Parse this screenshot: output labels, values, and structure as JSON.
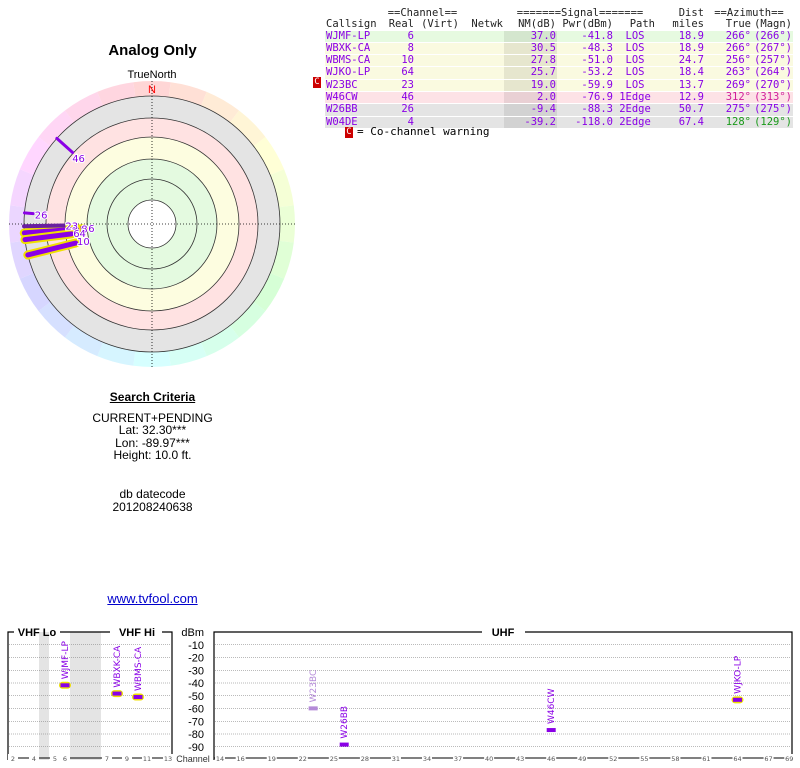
{
  "report": {
    "title": "Analog Only",
    "north_label": "TrueNorth",
    "north_marker": "N"
  },
  "table": {
    "group_headers": {
      "channel": "==Channel==",
      "signal": "=======Signal=======",
      "dist": "Dist",
      "azimuth": "==Azimuth=="
    },
    "headers": [
      "Callsign",
      "Real",
      "(Virt)",
      "Netwk",
      "NM(dB)",
      "Pwr(dBm)",
      "Path",
      "miles",
      "True",
      "(Magn)"
    ],
    "rows": [
      {
        "callsign": "WJMF-LP",
        "real": "6",
        "virt": "",
        "netwk": "",
        "nm": "37.0",
        "pwr": "-41.8",
        "path": "LOS",
        "dist": "18.9",
        "true": "266°",
        "magn": "(266°)",
        "bg": "#e6fae0",
        "az_color": "#8a00e6",
        "cochannel": false
      },
      {
        "callsign": "WBXK-CA",
        "real": "8",
        "virt": "",
        "netwk": "",
        "nm": "30.5",
        "pwr": "-48.3",
        "path": "LOS",
        "dist": "18.9",
        "true": "266°",
        "magn": "(267°)",
        "bg": "#fafae0",
        "az_color": "#8a00e6",
        "cochannel": false
      },
      {
        "callsign": "WBMS-CA",
        "real": "10",
        "virt": "",
        "netwk": "",
        "nm": "27.8",
        "pwr": "-51.0",
        "path": "LOS",
        "dist": "24.7",
        "true": "256°",
        "magn": "(257°)",
        "bg": "#fafae0",
        "az_color": "#8a00e6",
        "cochannel": false
      },
      {
        "callsign": "WJKO-LP",
        "real": "64",
        "virt": "",
        "netwk": "",
        "nm": "25.7",
        "pwr": "-53.2",
        "path": "LOS",
        "dist": "18.4",
        "true": "263°",
        "magn": "(264°)",
        "bg": "#fafae0",
        "az_color": "#8a00e6",
        "cochannel": false
      },
      {
        "callsign": "W23BC",
        "real": "23",
        "virt": "",
        "netwk": "",
        "nm": "19.0",
        "pwr": "-59.9",
        "path": "LOS",
        "dist": "13.7",
        "true": "269°",
        "magn": "(270°)",
        "bg": "#fafae0",
        "az_color": "#8a00e6",
        "cochannel": true
      },
      {
        "callsign": "W46CW",
        "real": "46",
        "virt": "",
        "netwk": "",
        "nm": "2.0",
        "pwr": "-76.9",
        "path": "1Edge",
        "dist": "12.9",
        "true": "312°",
        "magn": "(313°)",
        "bg": "#fde2e6",
        "az_color": "#d0209a",
        "cochannel": false
      },
      {
        "callsign": "W26BB",
        "real": "26",
        "virt": "",
        "netwk": "",
        "nm": "-9.4",
        "pwr": "-88.3",
        "path": "2Edge",
        "dist": "50.7",
        "true": "275°",
        "magn": "(275°)",
        "bg": "#e4e4e4",
        "az_color": "#8a00e6",
        "cochannel": false
      },
      {
        "callsign": "W04DE",
        "real": "4",
        "virt": "",
        "netwk": "",
        "nm": "-39.2",
        "pwr": "-118.0",
        "path": "2Edge",
        "dist": "67.4",
        "true": "128°",
        "magn": "(129°)",
        "bg": "#e4e4e4",
        "az_color": "#1a9a1a",
        "cochannel": false
      }
    ],
    "cochannel_badge": "C",
    "legend_text": "= Co-channel warning"
  },
  "criteria": {
    "heading": "Search Criteria",
    "mode": "CURRENT+PENDING",
    "lat": "Lat: 32.30***",
    "lon": "Lon: -89.97***",
    "height": "Height: 10.0 ft."
  },
  "db": {
    "label": "db datecode",
    "value": "201208240638"
  },
  "link": "www.tvfool.com",
  "spectrum": {
    "vhf_lo": "VHF Lo",
    "vhf_hi": "VHF Hi",
    "uhf": "UHF",
    "unit": "dBm",
    "axis_label": "Channel",
    "db_ticks": [
      "-10",
      "-20",
      "-30",
      "-40",
      "-50",
      "-60",
      "-70",
      "-80",
      "-90"
    ],
    "vhf_ticks": [
      "2",
      "4",
      "5",
      "6",
      "7",
      "9",
      "11",
      "13"
    ],
    "uhf_ticks": [
      "14",
      "16",
      "19",
      "22",
      "25",
      "28",
      "31",
      "34",
      "37",
      "40",
      "43",
      "46",
      "49",
      "52",
      "55",
      "58",
      "61",
      "64",
      "67",
      "69"
    ]
  },
  "colors": {
    "station": "#8a00e6",
    "cochannel_station": "#b48ad8",
    "highlight": "#f0e000",
    "warning": "#c00000",
    "north": "#ff0000"
  }
}
